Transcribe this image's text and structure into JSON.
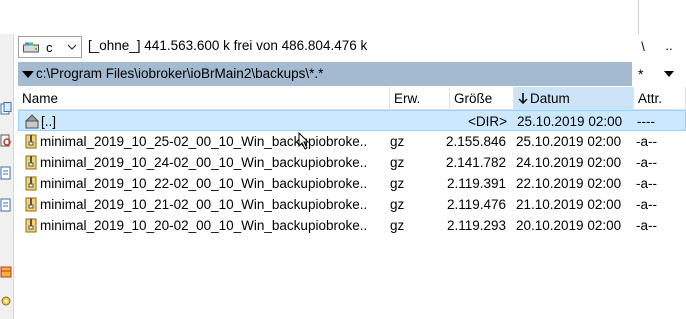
{
  "drive": {
    "letter": "c",
    "info": "[_ohne_]  441.563.600 k frei von 486.804.476 k",
    "root_label": "\\",
    "up_label": ".."
  },
  "path": {
    "text": "c:\\Program Files\\iobroker\\ioBrMain2\\backups\\*.*",
    "filter_label": "*"
  },
  "columns": {
    "name": "Name",
    "ext": "Erw.",
    "size": "Größe",
    "date": "Datum",
    "attr": "Attr."
  },
  "rows": [
    {
      "name": "[..]",
      "ext": "",
      "size": "<DIR>",
      "date": "25.10.2019 02:00",
      "attr": "----"
    },
    {
      "name": "minimal_2019_10_25-02_00_10_Win_backupiobroke..",
      "ext": "gz",
      "size": "2.155.846",
      "date": "25.10.2019 02:00",
      "attr": "-a--"
    },
    {
      "name": "minimal_2019_10_24-02_00_10_Win_backupiobroke..",
      "ext": "gz",
      "size": "2.141.782",
      "date": "24.10.2019 02:00",
      "attr": "-a--"
    },
    {
      "name": "minimal_2019_10_22-02_00_10_Win_backupiobroke..",
      "ext": "gz",
      "size": "2.119.391",
      "date": "22.10.2019 02:00",
      "attr": "-a--"
    },
    {
      "name": "minimal_2019_10_21-02_00_10_Win_backupiobroke..",
      "ext": "gz",
      "size": "2.119.476",
      "date": "21.10.2019 02:00",
      "attr": "-a--"
    },
    {
      "name": "minimal_2019_10_20-02_00_10_Win_backupiobroke..",
      "ext": "gz",
      "size": "2.119.293",
      "date": "20.10.2019 02:00",
      "attr": "-a--"
    }
  ],
  "icons": {
    "drive": "hard-drive-icon",
    "parent": "parent-folder-icon",
    "archive": "zip-archive-icon",
    "sort": "sort-descending-icon"
  },
  "colors": {
    "path_bar": "#a3bad0",
    "selection": "#cce8ff",
    "sorted_header": "#cce4f7"
  }
}
